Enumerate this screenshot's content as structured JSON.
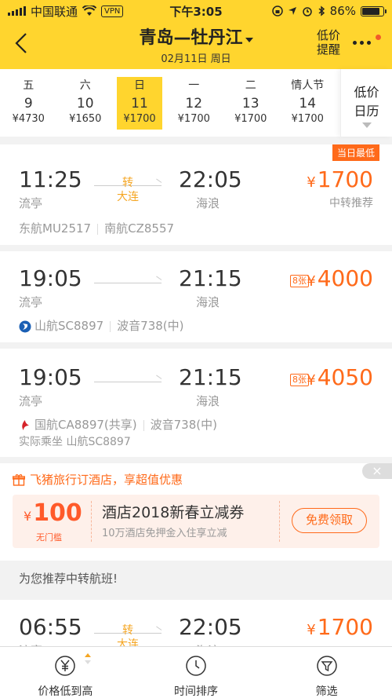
{
  "status": {
    "carrier": "中国联通",
    "vpn": "VPN",
    "time": "下午3:05",
    "battery": "86%",
    "battery_level": 0.86
  },
  "header": {
    "title": "青岛—牡丹江",
    "subtitle": "02月11日 周日",
    "alert_line1": "低价",
    "alert_line2": "提醒"
  },
  "dates": [
    {
      "weekday": "五",
      "day": "9",
      "price": "¥4730",
      "selected": false
    },
    {
      "weekday": "六",
      "day": "10",
      "price": "¥1650",
      "selected": false
    },
    {
      "weekday": "日",
      "day": "11",
      "price": "¥1700",
      "selected": true
    },
    {
      "weekday": "一",
      "day": "12",
      "price": "¥1700",
      "selected": false
    },
    {
      "weekday": "二",
      "day": "13",
      "price": "¥1700",
      "selected": false
    },
    {
      "weekday": "情人节",
      "day": "14",
      "price": "¥1700",
      "selected": false
    }
  ],
  "calendar": {
    "line1": "低价",
    "line2": "日历"
  },
  "flights": [
    {
      "badge": "当日最低",
      "depart_time": "11:25",
      "depart_place": "流亭",
      "transfer_label": "转",
      "transfer_city": "大连",
      "arrive_time": "22:05",
      "arrive_place": "海浪",
      "currency": "¥",
      "price": "1700",
      "price_note": "中转推荐",
      "airline1": "东航MU2517",
      "airline2": "南航CZ8557"
    },
    {
      "depart_time": "19:05",
      "depart_place": "流亭",
      "arrive_time": "21:15",
      "arrive_place": "海浪",
      "seats": "8张",
      "currency": "¥",
      "price": "4000",
      "airline": "山航SC8897",
      "aircraft": "波音738(中)"
    },
    {
      "depart_time": "19:05",
      "depart_place": "流亭",
      "arrive_time": "21:15",
      "arrive_place": "海浪",
      "seats": "8张",
      "currency": "¥",
      "price": "4050",
      "airline": "国航CA8897(共享)",
      "aircraft": "波音738(中)",
      "actual": "实际乘坐 山航SC8897"
    }
  ],
  "promo": {
    "headline": "飞猪旅行订酒店，享超值优惠",
    "close": "×",
    "currency": "¥",
    "amount": "100",
    "amount_sub": "无门槛",
    "title": "酒店2018新春立减券",
    "desc": "10万酒店免押金入住享立减",
    "button": "免费领取"
  },
  "recommend": {
    "section_title": "为您推荐中转航班!",
    "depart_time": "06:55",
    "depart_place": "流亭",
    "transfer_label": "转",
    "transfer_city": "大连",
    "arrive_time": "22:05",
    "arrive_place": "海浪",
    "currency": "¥",
    "price": "1700"
  },
  "tabbar": [
    {
      "label": "价格低到高",
      "icon": "yen-icon"
    },
    {
      "label": "时间排序",
      "icon": "clock-icon"
    },
    {
      "label": "筛选",
      "icon": "filter-icon"
    }
  ],
  "colors": {
    "brand": "#ffd52e",
    "price": "#ff6a1a",
    "transfer": "#f5a623"
  }
}
